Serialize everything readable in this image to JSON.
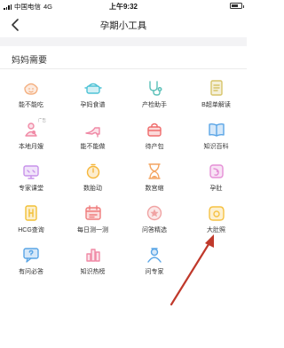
{
  "status_bar": {
    "carrier": "中国电信",
    "network": "4G",
    "time": "上午9:32",
    "battery_level": 0.7
  },
  "nav": {
    "title": "孕期小工具"
  },
  "section": {
    "title": "妈妈需要"
  },
  "tools": [
    {
      "label": "能不能吃",
      "icon": "bowl-face-icon",
      "color": "#f4b183"
    },
    {
      "label": "孕妈食谱",
      "icon": "pot-icon",
      "color": "#4fc3d6"
    },
    {
      "label": "产检助手",
      "icon": "stethoscope-icon",
      "color": "#5bc0b8"
    },
    {
      "label": "B超单解读",
      "icon": "ultrasound-report-icon",
      "color": "#d7c46a"
    },
    {
      "label": "本地月嫂",
      "icon": "nanny-icon",
      "color": "#f08aa6",
      "tag": "广告"
    },
    {
      "label": "能不能做",
      "icon": "high-heel-icon",
      "color": "#f08aa6"
    },
    {
      "label": "待产包",
      "icon": "bag-icon",
      "color": "#ef6c6c"
    },
    {
      "label": "知识百科",
      "icon": "book-icon",
      "color": "#5aa5e6"
    },
    {
      "label": "专家课堂",
      "icon": "tv-icon",
      "color": "#c792ea"
    },
    {
      "label": "数胎动",
      "icon": "timer-icon",
      "color": "#f6b73c"
    },
    {
      "label": "数宫缩",
      "icon": "hourglass-icon",
      "color": "#f4a460"
    },
    {
      "label": "孕肚",
      "icon": "belly-icon",
      "color": "#e58fd6"
    },
    {
      "label": "HCG查询",
      "icon": "hcg-icon",
      "color": "#f2c037"
    },
    {
      "label": "每日测一测",
      "icon": "calendar-check-icon",
      "color": "#ef7d7d"
    },
    {
      "label": "问答精选",
      "icon": "qa-star-icon",
      "color": "#f0a3a3"
    },
    {
      "label": "大肚照",
      "icon": "belly-photo-icon",
      "color": "#f6c244"
    },
    {
      "label": "有问必答",
      "icon": "question-bubble-icon",
      "color": "#5aa5e6"
    },
    {
      "label": "知识热榜",
      "icon": "bar-chart-icon",
      "color": "#f08aa6"
    },
    {
      "label": "问专家",
      "icon": "doctor-icon",
      "color": "#5aa5e6"
    }
  ],
  "annotation": {
    "arrow_color": "#c0392b"
  }
}
